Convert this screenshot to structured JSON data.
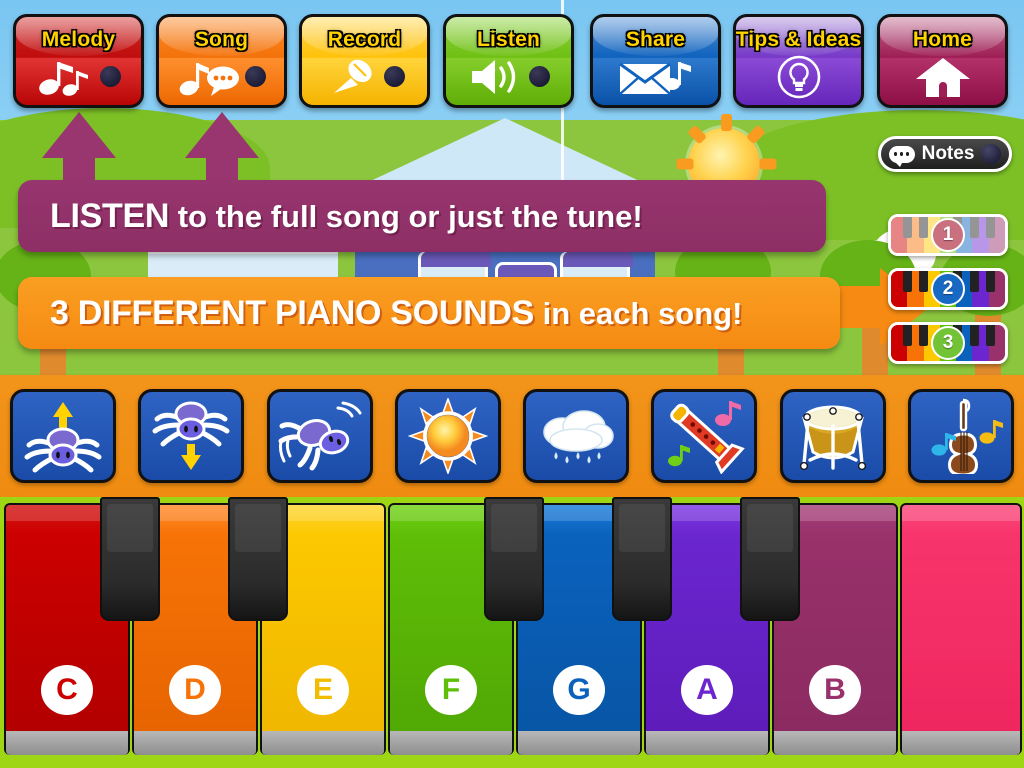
{
  "topbar": {
    "buttons": [
      {
        "label": "Melody",
        "icon": "music-notes-icon",
        "has_dot": true,
        "color": "#c00c0c"
      },
      {
        "label": "Song",
        "icon": "note-speech-icon",
        "has_dot": true,
        "color": "#f4720a"
      },
      {
        "label": "Record",
        "icon": "microphone-icon",
        "has_dot": true,
        "color": "#ffc20a"
      },
      {
        "label": "Listen",
        "icon": "speaker-icon",
        "has_dot": true,
        "color": "#6fc013"
      },
      {
        "label": "Share",
        "icon": "envelope-note-icon",
        "has_dot": false,
        "color": "#0f62bd"
      },
      {
        "label": "Tips & Ideas",
        "icon": "lightbulb-icon",
        "has_dot": false,
        "color": "#7638c9"
      },
      {
        "label": "Home",
        "icon": "house-icon",
        "has_dot": false,
        "color": "#9e1e55"
      }
    ]
  },
  "banners": [
    {
      "id": "listen",
      "text_strong": "LISTEN",
      "text_rest": " to the full song or just the tune!",
      "color": "#97356e"
    },
    {
      "id": "sounds",
      "text_strong": "3 DIFFERENT PIANO SOUNDS",
      "text_rest": " in each song!",
      "color": "#f68a12"
    }
  ],
  "notes_button": {
    "label": "Notes",
    "icon": "speech-bubble-icon"
  },
  "piano_sounds": [
    {
      "number": "1",
      "badge_color": "#c9717f",
      "active": false
    },
    {
      "number": "2",
      "badge_color": "#1769c4",
      "active": true
    },
    {
      "number": "3",
      "badge_color": "#72c335",
      "active": true
    }
  ],
  "instruments": [
    {
      "name": "spider-up",
      "icon": "spider-up-icon"
    },
    {
      "name": "spider-down",
      "icon": "spider-down-icon"
    },
    {
      "name": "spider-swing",
      "icon": "spider-swing-icon"
    },
    {
      "name": "sun",
      "icon": "sun-icon"
    },
    {
      "name": "rain-cloud",
      "icon": "rain-cloud-icon"
    },
    {
      "name": "recorder",
      "icon": "recorder-flute-icon"
    },
    {
      "name": "timpani",
      "icon": "timpani-drum-icon"
    },
    {
      "name": "cello",
      "icon": "cello-icon"
    }
  ],
  "keyboard": {
    "white_keys": [
      {
        "note": "C",
        "color": "#cc0000",
        "label_color": "#cc0000"
      },
      {
        "note": "D",
        "color": "#f77307",
        "label_color": "#f77307"
      },
      {
        "note": "E",
        "color": "#fcc800",
        "label_color": "#f0bd00"
      },
      {
        "note": "F",
        "color": "#5fbe07",
        "label_color": "#5fbe07"
      },
      {
        "note": "G",
        "color": "#0a62bd",
        "label_color": "#0a62bd"
      },
      {
        "note": "A",
        "color": "#6b26cf",
        "label_color": "#6b26cf"
      },
      {
        "note": "B",
        "color": "#99316b",
        "label_color": "#99316b"
      },
      {
        "note": "",
        "color": "#f7346b",
        "label_color": "#f7346b"
      }
    ],
    "black_keys": [
      {
        "note": "C#"
      },
      {
        "note": "D#"
      },
      {
        "note": "F#"
      },
      {
        "note": "G#"
      },
      {
        "note": "A#"
      }
    ]
  },
  "colors": {
    "sky": "#79c6f2",
    "grass": "#8cc63e",
    "keyboard_frame": "#9ed515",
    "instrument_bar": "#ef8b10",
    "instrument_tile": "#1a4ba8"
  }
}
